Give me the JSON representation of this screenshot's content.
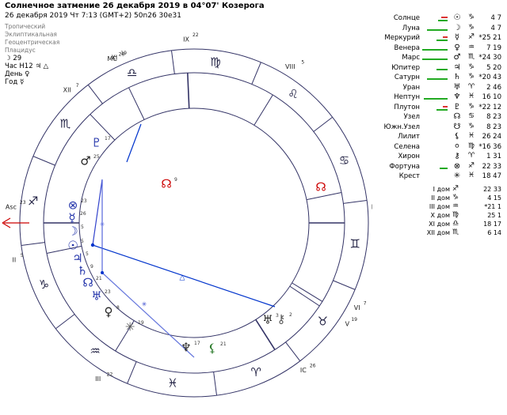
{
  "header": {
    "title": "Солнечное затмение 26 декабря 2019 в 04°07' Козерога",
    "subtitle": "26 декабря 2019  Чт   7:13 (GMT+2) 50n26  30e31",
    "modes": [
      "Тропический",
      "Эклиптикальная",
      "Геоцентрическая",
      "Плацидус"
    ],
    "extra": [
      {
        "label": "",
        "value": "29",
        "glyph": "☽"
      },
      {
        "label": "Час Н12",
        "value": "",
        "glyph": "♃ △"
      },
      {
        "label": "День",
        "value": "",
        "glyph": "♀"
      },
      {
        "label": "Год",
        "value": "",
        "glyph": "☿"
      }
    ]
  },
  "colors": {
    "ring": "#333366",
    "aspect_blue": "#0033cc",
    "aspect_red": "#dd0000",
    "planet": "#2233aa",
    "bar_red": "#dd3333",
    "bar_green": "#22aa22",
    "accent": "#cc0000"
  },
  "planets": [
    {
      "name": "Солнце",
      "glyph": "☉",
      "sign": "♑",
      "pos": "4♑7",
      "deg": "4",
      "min": "7",
      "red": 8,
      "green": 12
    },
    {
      "name": "Луна",
      "glyph": "☽",
      "sign": "♑",
      "pos": "4♑7",
      "deg": "4",
      "min": "7",
      "red": 0,
      "green": 26
    },
    {
      "name": "Меркурий",
      "glyph": "☿",
      "sign": "♐",
      "pos": "*25♐21",
      "deg": "*25",
      "min": "21",
      "red": 6,
      "green": 14
    },
    {
      "name": "Венера",
      "glyph": "♀",
      "sign": "♒",
      "pos": "7♒19",
      "deg": "7",
      "min": "19",
      "red": 0,
      "green": 32
    },
    {
      "name": "Марс",
      "glyph": "♂",
      "sign": "♏",
      "pos": "*24♏30",
      "deg": "*24",
      "min": "30",
      "red": 0,
      "green": 32
    },
    {
      "name": "Юпитер",
      "glyph": "♃",
      "sign": "♑",
      "pos": "5♑20",
      "deg": "5",
      "min": "20",
      "red": 0,
      "green": 14
    },
    {
      "name": "Сатурн",
      "glyph": "♄",
      "sign": "♑",
      "pos": "*20♑43",
      "deg": "*20",
      "min": "43",
      "red": 0,
      "green": 26
    },
    {
      "name": "Уран",
      "glyph": "♅",
      "sign": "♈",
      "pos": "2♉46",
      "deg": "2",
      "min": "46",
      "red": 0,
      "green": 0
    },
    {
      "name": "Нептун",
      "glyph": "♆",
      "sign": "♓",
      "pos": "16♓10",
      "deg": "16",
      "min": "10",
      "red": 0,
      "green": 30
    },
    {
      "name": "Плутон",
      "glyph": "♇",
      "sign": "♑",
      "pos": "*22♑12",
      "deg": "*22",
      "min": "12",
      "red": 6,
      "green": 14
    },
    {
      "name": "Узел",
      "glyph": "☊",
      "sign": "♋",
      "pos": "8♋23",
      "deg": "8",
      "min": "23",
      "red": 0,
      "green": 0
    },
    {
      "name": "Южн.Узел",
      "glyph": "☋",
      "sign": "♑",
      "pos": "8♑23",
      "deg": "8",
      "min": "23",
      "red": 0,
      "green": 0
    },
    {
      "name": "Лилит",
      "glyph": "⚸",
      "sign": "♓",
      "pos": "26♓24",
      "deg": "26",
      "min": "24",
      "red": 0,
      "green": 0
    },
    {
      "name": "Селена",
      "glyph": "⚪",
      "sign": "♍",
      "pos": "*16♍36",
      "deg": "*16",
      "min": "36",
      "red": 0,
      "green": 0
    },
    {
      "name": "Хирон",
      "glyph": "⚷",
      "sign": "♈",
      "pos": "1♈31",
      "deg": "1",
      "min": "31",
      "red": 0,
      "green": 0
    },
    {
      "name": "Фортуна",
      "glyph": "⊗",
      "sign": "♐",
      "pos": "22♐33",
      "deg": "22",
      "min": "33",
      "red": 0,
      "green": 10
    },
    {
      "name": "Крест",
      "glyph": "✳",
      "sign": "♓",
      "pos": "18♓47",
      "deg": "18",
      "min": "47",
      "red": 0,
      "green": 0
    }
  ],
  "houses": [
    {
      "name": "I дом",
      "sign": "♐",
      "deg": "22",
      "min": "33"
    },
    {
      "name": "II дом",
      "sign": "♑",
      "deg": "4",
      "min": "15"
    },
    {
      "name": "III дом",
      "sign": "♒",
      "deg": "*21",
      "min": "1"
    },
    {
      "name": "X дом",
      "sign": "♍",
      "deg": "25",
      "min": "1"
    },
    {
      "name": "XI дом",
      "sign": "♎",
      "deg": "18",
      "min": "17"
    },
    {
      "name": "XII дом",
      "sign": "♏",
      "deg": "6",
      "min": "14"
    }
  ],
  "chart_labels": {
    "asc": "Asc",
    "asc_deg": "23",
    "dsc": "Dsc",
    "dsc_deg": "23",
    "mc": "MC",
    "mc_deg": "28",
    "ic": "IC",
    "ic_deg": "26",
    "h2": "II",
    "h2_deg": "5",
    "h3": "III",
    "h3_deg": "22",
    "h5": "V",
    "h5_deg": "19",
    "h6": "VI",
    "h6_deg": "7",
    "h8": "VIII",
    "h8_deg": "5",
    "h9": "IX",
    "h9_deg": "22",
    "h11": "XI",
    "h11_deg": "19",
    "h12": "XII",
    "h12_deg": "7"
  },
  "chart_planets": [
    {
      "glyph": "♇",
      "deg": "17"
    },
    {
      "glyph": "♂",
      "deg": "25"
    },
    {
      "glyph": "⊗",
      "deg": "23"
    },
    {
      "glyph": "☿",
      "deg": "26"
    },
    {
      "glyph": "☽",
      "deg": "5"
    },
    {
      "glyph": "☉",
      "deg": "5"
    },
    {
      "glyph": "♃",
      "deg": "5"
    },
    {
      "glyph": "♄",
      "deg": "9"
    },
    {
      "glyph": "☊",
      "deg": "21"
    },
    {
      "glyph": "♅",
      "deg": "23"
    },
    {
      "glyph": "♀",
      "deg": "8"
    },
    {
      "glyph": "✳",
      "deg": "19"
    },
    {
      "glyph": "♆",
      "deg": "17"
    },
    {
      "glyph": "⚸",
      "deg": "21"
    },
    {
      "glyph": "⚷",
      "deg": "2"
    },
    {
      "glyph": "♅",
      "deg": "3"
    },
    {
      "glyph": "☊",
      "deg": "9"
    }
  ],
  "zodiac": [
    "♈",
    "♉",
    "♊",
    "♋",
    "♌",
    "♍",
    "♎",
    "♏",
    "♐",
    "♑",
    "♒",
    "♓"
  ]
}
